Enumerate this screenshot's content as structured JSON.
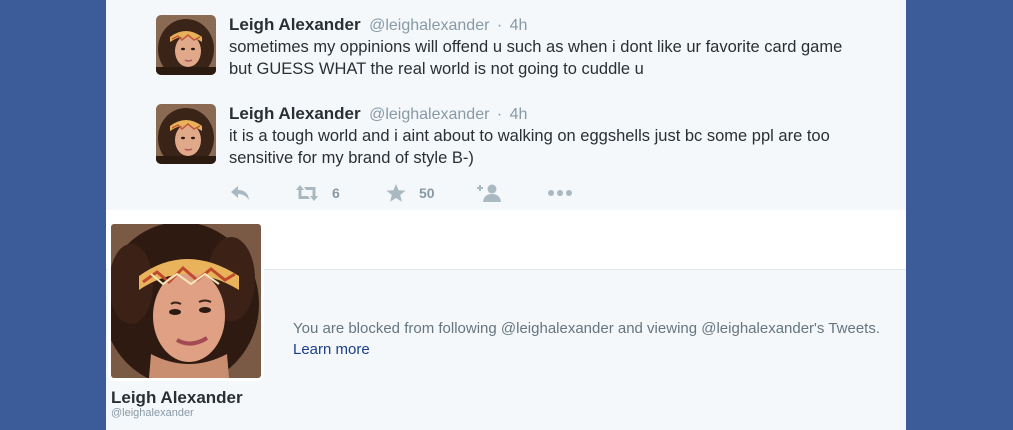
{
  "tweets": [
    {
      "name": "Leigh Alexander",
      "handle": "@leighalexander",
      "dot": "·",
      "time": "4h",
      "text": "sometimes my oppinions will offend u such as when i dont like ur favorite card game but GUESS WHAT the real world is not going to cuddle u",
      "avatar": "user-avatar"
    },
    {
      "name": "Leigh Alexander",
      "handle": "@leighalexander",
      "dot": "·",
      "time": "4h",
      "text": "it is a tough world and i aint about to walking on eggshells just bc some ppl are too sensitive for my brand of style B-)",
      "avatar": "user-avatar"
    }
  ],
  "actions": {
    "reply_icon": "reply-icon",
    "retweet_icon": "retweet-icon",
    "retweet_count": "6",
    "favorite_icon": "star-icon",
    "favorite_count": "50",
    "follow_icon": "follow-user-icon",
    "more_icon": "more-icon"
  },
  "profile": {
    "name": "Leigh Alexander",
    "handle": "@leighalexander"
  },
  "blocked": {
    "message": "You are blocked from following @leighalexander and viewing @leighalexander's Tweets.",
    "link": "Learn more"
  },
  "colors": {
    "page_background": "#3b5b99",
    "panel_background": "#f5f8fa",
    "name_text": "#292f33",
    "muted_text": "#8899a6",
    "link": "#1b3e8a",
    "action_icon": "#aab8c2"
  }
}
